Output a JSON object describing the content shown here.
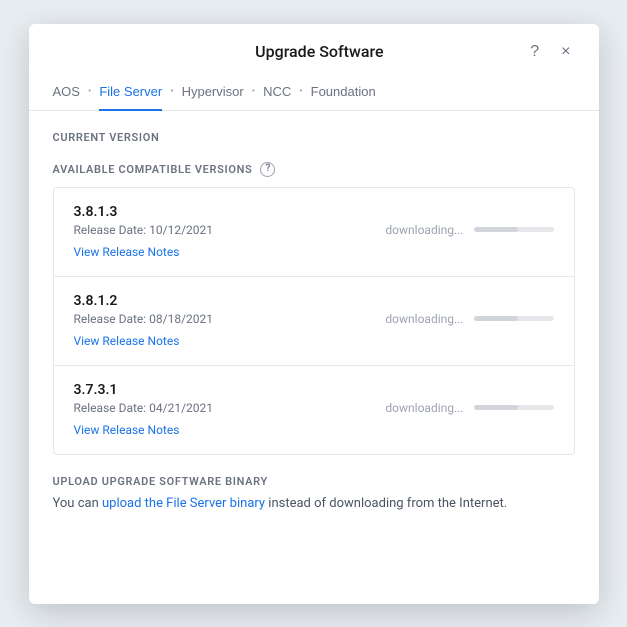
{
  "modal": {
    "title": "Upgrade Software",
    "help_label": "?",
    "close_label": "×"
  },
  "tabs": {
    "items": [
      {
        "id": "aos",
        "label": "AOS"
      },
      {
        "id": "file-server",
        "label": "File Server",
        "active": true
      },
      {
        "id": "hypervisor",
        "label": "Hypervisor"
      },
      {
        "id": "ncc",
        "label": "NCC"
      },
      {
        "id": "foundation",
        "label": "Foundation"
      }
    ]
  },
  "current_version": {
    "label": "CURRENT VERSION"
  },
  "available_versions": {
    "label": "AVAILABLE COMPATIBLE VERSIONS",
    "help": "?",
    "items": [
      {
        "version": "3.8.1.3",
        "release_date": "Release Date: 10/12/2021",
        "download_status": "downloading...",
        "view_notes_label": "View Release Notes"
      },
      {
        "version": "3.8.1.2",
        "release_date": "Release Date: 08/18/2021",
        "download_status": "downloading...",
        "view_notes_label": "View Release Notes"
      },
      {
        "version": "3.7.3.1",
        "release_date": "Release Date: 04/21/2021",
        "download_status": "downloading...",
        "view_notes_label": "View Release Notes"
      }
    ]
  },
  "upload_section": {
    "label": "UPLOAD UPGRADE SOFTWARE BINARY",
    "text_before": "You can ",
    "link_text": "upload the File Server binary",
    "text_after": " instead of downloading from the Internet."
  }
}
